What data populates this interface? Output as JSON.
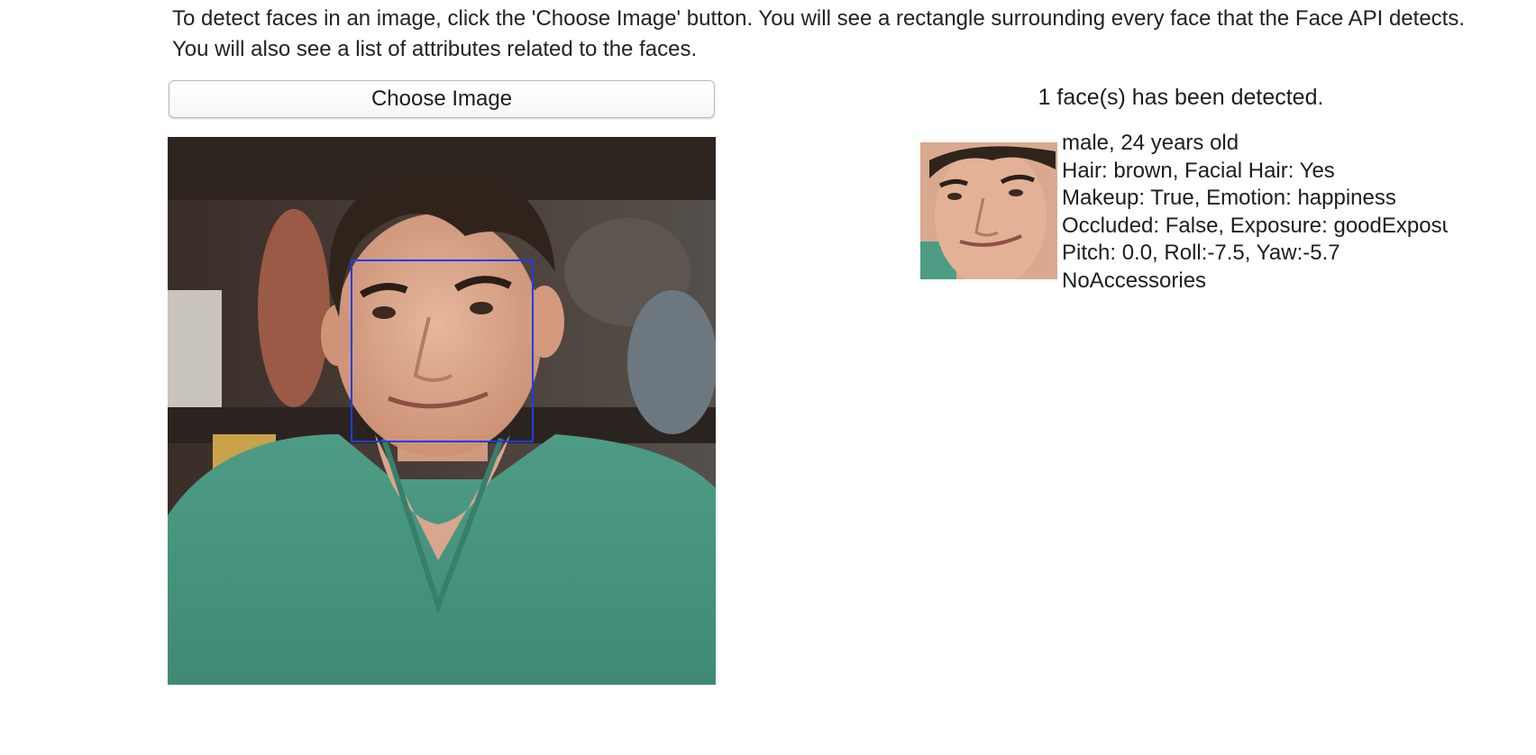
{
  "instructions": "To detect faces in an image, click the 'Choose Image' button. You will see a rectangle surrounding every face that the Face API detects. You will also see a list of attributes related to the faces.",
  "choose_button_label": "Choose Image",
  "detected_count": "1 face(s) has been detected.",
  "face_box_color": "#1f3df0",
  "faces": [
    {
      "summary": "male, 24 years old",
      "hair": "Hair: brown, Facial Hair: Yes",
      "makeup": "Makeup: True, Emotion: happiness",
      "occlusion": "Occluded: False, Exposure: goodExposure",
      "pose": "Pitch: 0.0, Roll:-7.5, Yaw:-5.7",
      "accessories": "NoAccessories"
    }
  ]
}
